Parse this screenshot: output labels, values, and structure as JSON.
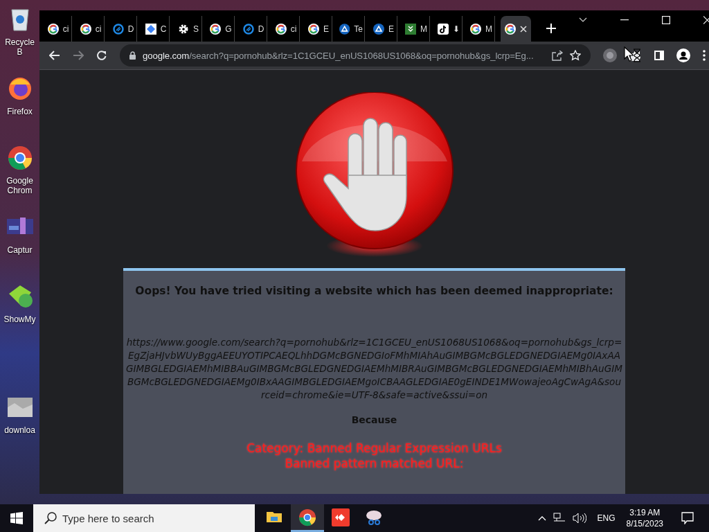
{
  "desktop_icons": [
    {
      "kind": "recycle",
      "label": "Recycle B"
    },
    {
      "kind": "firefox",
      "label": "Firefox"
    },
    {
      "kind": "chrome",
      "label": "Google Chrom"
    },
    {
      "kind": "capture",
      "label": "Captur"
    },
    {
      "kind": "showmy",
      "label": "ShowMy"
    },
    {
      "kind": "download",
      "label": "downloa"
    }
  ],
  "browser": {
    "tabs": [
      {
        "kind": "google",
        "label": "ci",
        "selected": false
      },
      {
        "kind": "google",
        "label": "ci",
        "selected": false
      },
      {
        "kind": "ring",
        "label": "D",
        "selected": false
      },
      {
        "kind": "diamond",
        "label": "C",
        "selected": false
      },
      {
        "kind": "gear",
        "label": "S",
        "selected": false
      },
      {
        "kind": "google",
        "label": "G",
        "selected": false
      },
      {
        "kind": "ring",
        "label": "D",
        "selected": false
      },
      {
        "kind": "google",
        "label": "ci",
        "selected": false
      },
      {
        "kind": "google",
        "label": "E",
        "selected": false
      },
      {
        "kind": "triangle",
        "label": "Te",
        "selected": false
      },
      {
        "kind": "triangle",
        "label": "E",
        "selected": false
      },
      {
        "kind": "green",
        "label": "M",
        "selected": false
      },
      {
        "kind": "note",
        "label": "⬇",
        "selected": false
      },
      {
        "kind": "google",
        "label": "M",
        "selected": false
      },
      {
        "kind": "google",
        "selected": true
      }
    ],
    "address": {
      "host": "google.com",
      "path": "/search?q=pornohub&rlz=1C1GCEU_enUS1068US1068&oq=pornohub&gs_lcrp=Eg..."
    }
  },
  "block_page": {
    "heading": "Oops! You have tried visiting a website which has been deemed inappropriate:",
    "url": "https://www.google.com/search?q=pornohub&rlz=1C1GCEU_enUS1068US1068&oq=pornohub&gs_lcrp=EgZjaHJvbWUyBggAEEUYOTIPCAEQLhhDGMcBGNEDGIoFMhMIAhAuGIMBGMcBGLEDGNEDGIAEMg0IAxAAGIMBGLEDGIAEMhMIBBAuGIMBGMcBGLEDGNEDGIAEMhMIBRAuGIMBGMcBGLEDGNEDGIAEMhMIBhAuGIMBGMcBGLEDGNEDGIAEMg0IBxAAGIMBGLEDGIAEMgoICBAAGLEDGIAE0gEINDE1MWowajeoAgCwAgA&sourceid=chrome&ie=UTF-8&safe=active&ssui=on",
    "because": "Because",
    "reasons": [
      "Category: Banned Regular Expression URLs",
      "Banned pattern matched URL:"
    ]
  },
  "taskbar": {
    "search": {
      "placeholder": "Type here to search"
    },
    "apps": [
      {
        "kind": "explorer",
        "selected": false
      },
      {
        "kind": "chrome",
        "selected": true
      },
      {
        "kind": "redapp",
        "selected": false
      },
      {
        "kind": "snip",
        "selected": false
      }
    ],
    "language": "ENG",
    "time": "3:19 AM",
    "date": "8/15/2023"
  }
}
